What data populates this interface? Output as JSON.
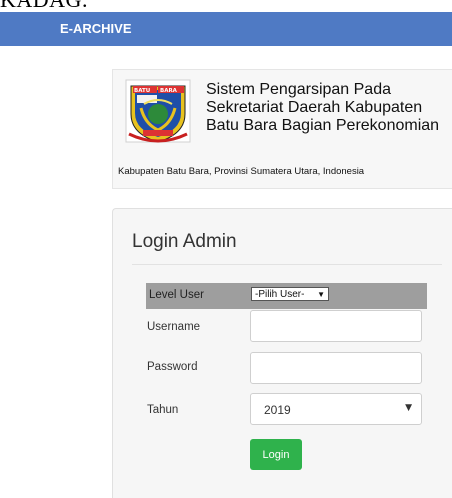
{
  "top_cut_text": "KADAG.",
  "navbar": {
    "brand": "E-ARCHIVE"
  },
  "header": {
    "logo_text": "BATU BARA",
    "title": "Sistem Pengarsipan Pada Sekretariat Daerah Kabupaten Batu Bara Bagian Perekonomian",
    "subtitle": "Kabupaten Batu Bara, Provinsi Sumatera Utara, Indonesia"
  },
  "login": {
    "title": "Login Admin",
    "level_label": "Level User",
    "level_value": "-Pilih User-",
    "username_label": "Username",
    "username_value": "",
    "password_label": "Password",
    "password_value": "",
    "year_label": "Tahun",
    "year_value": "2019",
    "submit_label": "Login"
  },
  "colors": {
    "navbar": "#4f7ac4",
    "level_row": "#9e9e9e",
    "login_button": "#2fb24c"
  }
}
